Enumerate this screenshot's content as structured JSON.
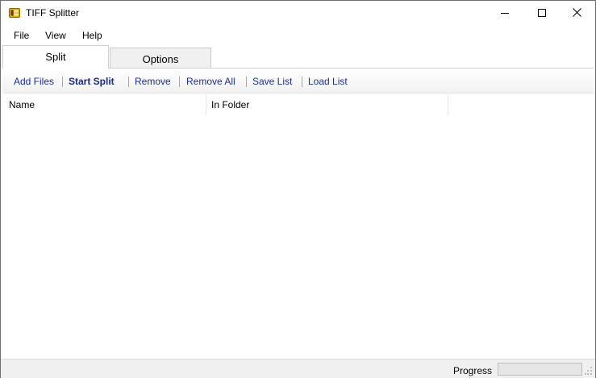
{
  "window": {
    "title": "TIFF Splitter",
    "icon": "tiff-app-icon"
  },
  "titlebar_controls": {
    "minimize_icon": "minimize-icon",
    "maximize_icon": "maximize-icon",
    "close_icon": "close-icon"
  },
  "menu": {
    "file": "File",
    "view": "View",
    "help": "Help"
  },
  "tabs": [
    {
      "label": "Split",
      "active": true
    },
    {
      "label": "Options",
      "active": false
    }
  ],
  "toolbar": {
    "add_files": "Add Files",
    "start_split": "Start Split",
    "remove": "Remove",
    "remove_all": "Remove All",
    "save_list": "Save List",
    "load_list": "Load List"
  },
  "list": {
    "columns": [
      "Name",
      "In Folder"
    ],
    "rows": []
  },
  "status": {
    "progress_label": "Progress",
    "progress_value": 0
  },
  "colors": {
    "link": "#1c2e9c",
    "progress_fill": "#06b025"
  }
}
